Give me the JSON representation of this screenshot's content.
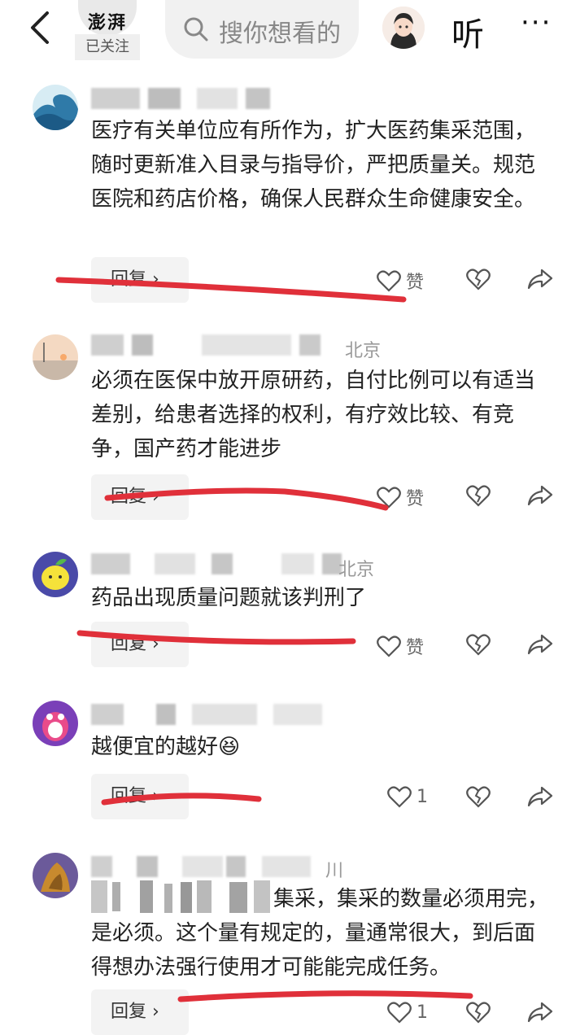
{
  "header": {
    "logo_text": "澎湃",
    "follow_label": "已关注",
    "search_placeholder": "搜你想看的",
    "listen_label": "听",
    "more_label": "···"
  },
  "comments": [
    {
      "location": "",
      "text": "医疗有关单位应有所作为，扩大医药集采范围，随时更新准入目录与指导价，严把质量关。规范医院和药店价格，确保人民群众生命健康安全。",
      "reply_label": "回复 ›",
      "like_label": "赞"
    },
    {
      "location": "北京",
      "text": "必须在医保中放开原研药，自付比例可以有适当差别，给患者选择的权利，有疗效比较、有竞争，国产药才能进步",
      "reply_label": "回复 ›",
      "like_label": "赞"
    },
    {
      "location": "北京",
      "text": "药品出现质量问题就该判刑了",
      "reply_label": "回复 ›",
      "like_label": "赞"
    },
    {
      "location": "",
      "text": "越便宜的越好😆",
      "reply_label": "回复 ›",
      "like_label": "1"
    },
    {
      "location": "川",
      "text": "集采，集采的数量必须用完，是必须。这个量有规定的，量通常很大，到后面得想办法强行使用才可能能完成任务。",
      "reply_label": "回复 ›",
      "like_label": "1"
    }
  ],
  "colors": {
    "annotation_red": "#e0303a",
    "muted": "#999999"
  },
  "icons": [
    "back-arrow-icon",
    "search-icon",
    "heart-icon",
    "broken-heart-icon",
    "share-icon"
  ]
}
